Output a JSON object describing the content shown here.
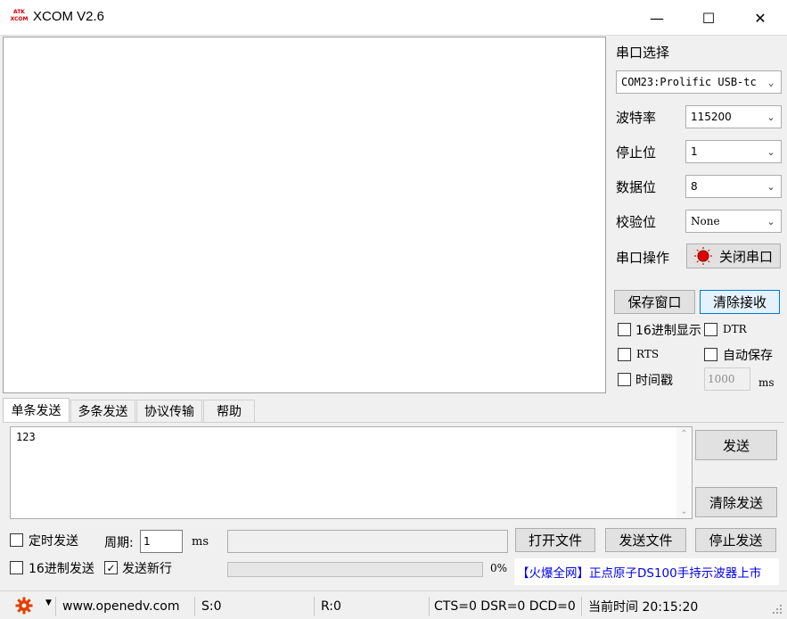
{
  "window": {
    "logo_line1": "ATK",
    "logo_line2": "XCOM",
    "title": "XCOM V2.6",
    "minimize": "—",
    "maximize": "☐",
    "close": "✕"
  },
  "serial": {
    "section_label": "串口选择",
    "port_value": "COM23:Prolific USB-tc",
    "baud_label": "波特率",
    "baud_value": "115200",
    "stop_label": "停止位",
    "stop_value": "1",
    "data_label": "数据位",
    "data_value": "8",
    "parity_label": "校验位",
    "parity_value": "None",
    "operate_label": "串口操作",
    "operate_button": "关闭串口",
    "save_window": "保存窗口",
    "clear_receive": "清除接收",
    "hex_display": "16进制显示",
    "dtr": "DTR",
    "rts": "RTS",
    "auto_save": "自动保存",
    "timestamp": "时间戳",
    "timestamp_value": "1000",
    "timestamp_unit": "ms"
  },
  "tabs": [
    "单条发送",
    "多条发送",
    "协议传输",
    "帮助"
  ],
  "send": {
    "text": "123",
    "send_button": "发送",
    "clear_send": "清除发送",
    "timed_send": "定时发送",
    "period_label": "周期:",
    "period_value": "1",
    "period_unit": "ms",
    "open_file": "打开文件",
    "send_file": "发送文件",
    "stop_send": "停止发送",
    "hex_send": "16进制发送",
    "send_newline": "发送新行",
    "progress_text": "0%",
    "progress": 0,
    "ad_text": "【火爆全网】正点原子DS100手持示波器上市"
  },
  "status": {
    "website": "www.openedv.com",
    "sent": "S:0",
    "received": "R:0",
    "lines": "CTS=0 DSR=0 DCD=0",
    "time": "当前时间 20:15:20"
  },
  "colors": {
    "accent": "#0078d7",
    "ad_text": "#0000ee",
    "indicator_red": "#e00000",
    "gear": "#e04000"
  }
}
